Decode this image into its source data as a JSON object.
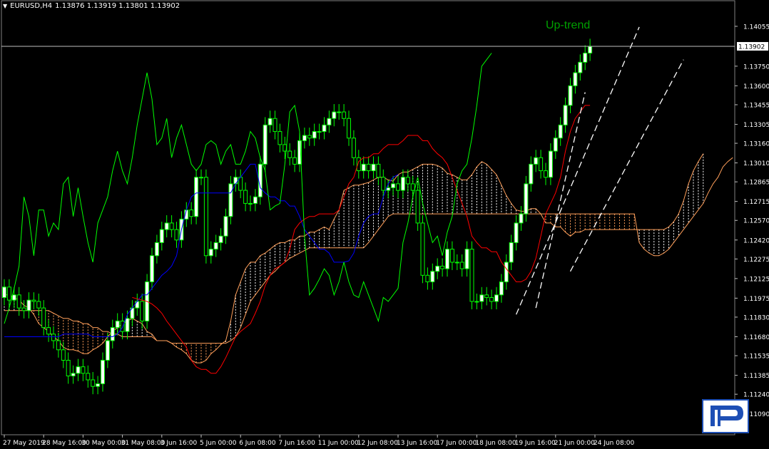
{
  "header": {
    "menu_icon": "triangle-down-icon",
    "symbol": "EURUSD,H4",
    "ohlc": "1.13876 1.13919 1.13801 1.13902"
  },
  "colors": {
    "background": "#000000",
    "bull_candle": "#ffffff",
    "bear_candle": "#000000",
    "candle_outline": "#00ff00",
    "tenkan": "#ff0000",
    "kijun": "#0000ff",
    "chikou": "#00ff00",
    "kumo_bull": "#ffffff",
    "kumo_bear": "#ff9f5a",
    "trend_line": "#ffffff",
    "annotation": "#00a000",
    "price_line": "#c0c0c0"
  },
  "chart_data": {
    "type": "candlestick",
    "symbol": "EURUSD",
    "timeframe": "H4",
    "indicator": "Ichimoku Kinko Hyo",
    "annotation": "Up-trend",
    "current_price": 1.13902,
    "current_price_label": "1.13902",
    "ylim": [
      1.1093,
      1.1418
    ],
    "y_ticks": [
      "1.14055",
      "1.13750",
      "1.13600",
      "1.13455",
      "1.13305",
      "1.13160",
      "1.13010",
      "1.12865",
      "1.12715",
      "1.12570",
      "1.12420",
      "1.12275",
      "1.12125",
      "1.11975",
      "1.11830",
      "1.11680",
      "1.11535",
      "1.11385",
      "1.11240",
      "1.11090"
    ],
    "y_tick_values": [
      1.14055,
      1.1375,
      1.136,
      1.13455,
      1.13305,
      1.1316,
      1.1301,
      1.12865,
      1.12715,
      1.1257,
      1.1242,
      1.12275,
      1.12125,
      1.11975,
      1.1183,
      1.1168,
      1.11535,
      1.11385,
      1.1124,
      1.1109
    ],
    "x_ticks": [
      "27 May 2019",
      "28 May 16:00",
      "30 May 00:00",
      "31 May 08:00",
      "3 Jun 16:00",
      "5 Jun 00:00",
      "6 Jun 08:00",
      "7 Jun 16:00",
      "11 Jun 00:00",
      "12 Jun 08:00",
      "13 Jun 16:00",
      "17 Jun 00:00",
      "18 Jun 08:00",
      "19 Jun 16:00",
      "21 Jun 00:00",
      "24 Jun 08:00"
    ],
    "x_tick_index": [
      0,
      8,
      16,
      24,
      32,
      40,
      48,
      56,
      64,
      72,
      80,
      88,
      96,
      104,
      112,
      120
    ],
    "total_slots": 149,
    "candles_close": [
      1.1206,
      1.1196,
      1.12,
      1.119,
      1.1188,
      1.1196,
      1.1195,
      1.119,
      1.1175,
      1.117,
      1.1165,
      1.1158,
      1.115,
      1.1138,
      1.114,
      1.1145,
      1.114,
      1.1135,
      1.113,
      1.1132,
      1.115,
      1.1165,
      1.1175,
      1.118,
      1.1172,
      1.1182,
      1.119,
      1.1195,
      1.118,
      1.121,
      1.123,
      1.124,
      1.125,
      1.1255,
      1.125,
      1.1242,
      1.1258,
      1.1265,
      1.126,
      1.129,
      1.129,
      1.123,
      1.1235,
      1.124,
      1.1245,
      1.126,
      1.1285,
      1.129,
      1.128,
      1.127,
      1.127,
      1.1275,
      1.13,
      1.133,
      1.1335,
      1.1325,
      1.1315,
      1.131,
      1.1305,
      1.13,
      1.1318,
      1.1322,
      1.132,
      1.1325,
      1.1325,
      1.133,
      1.1335,
      1.134,
      1.134,
      1.1335,
      1.132,
      1.1305,
      1.1295,
      1.13,
      1.1295,
      1.13,
      1.129,
      1.128,
      1.1282,
      1.1285,
      1.128,
      1.129,
      1.1285,
      1.128,
      1.1255,
      1.1215,
      1.121,
      1.1218,
      1.1222,
      1.122,
      1.1235,
      1.1225,
      1.1225,
      1.122,
      1.1235,
      1.1195,
      1.1195,
      1.12,
      1.1198,
      1.1195,
      1.12,
      1.121,
      1.1225,
      1.124,
      1.1255,
      1.1262,
      1.1285,
      1.13,
      1.1305,
      1.1295,
      1.129,
      1.131,
      1.132,
      1.133,
      1.1345,
      1.136,
      1.137,
      1.1378,
      1.1385,
      1.139
    ],
    "tenkan_sen": [
      1.1198,
      1.1197,
      1.1196,
      1.1195,
      1.1193,
      1.119,
      1.1186,
      1.118,
      1.1175,
      1.117,
      1.1165,
      1.116,
      1.115,
      1.1145,
      1.1143,
      1.1143,
      1.114,
      1.114,
      1.1145,
      1.1152,
      1.116,
      1.1168,
      1.1172,
      1.1175,
      1.1178,
      1.1186,
      1.1195,
      1.1207,
      1.1215,
      1.122,
      1.1222,
      1.1225,
      1.1235,
      1.125,
      1.1255,
      1.1258,
      1.126,
      1.126,
      1.1262,
      1.1262,
      1.1262,
      1.1262,
      1.1265,
      1.1275,
      1.1285,
      1.129,
      1.1302,
      1.1305,
      1.1305,
      1.1308,
      1.1308,
      1.1312,
      1.1315,
      1.1315,
      1.1315,
      1.1318,
      1.1322,
      1.1322,
      1.1322,
      1.1318,
      1.1318,
      1.1312,
      1.1308,
      1.1305,
      1.13,
      1.129,
      1.128,
      1.127,
      1.126,
      1.1245,
      1.124,
      1.1236,
      1.1236,
      1.1233,
      1.1233,
      1.1225,
      1.122,
      1.1215,
      1.121,
      1.121,
      1.1212,
      1.1218,
      1.1228,
      1.1245,
      1.1262,
      1.127,
      1.1278,
      1.129,
      1.131,
      1.1325,
      1.1335,
      1.134,
      1.1345,
      1.1345
    ],
    "kijun_sen": [
      1.1168,
      1.1168,
      1.1168,
      1.1168,
      1.1168,
      1.1168,
      1.1168,
      1.1168,
      1.1168,
      1.1168,
      1.1168,
      1.1168,
      1.117,
      1.117,
      1.117,
      1.117,
      1.117,
      1.117,
      1.1168,
      1.1168,
      1.1168,
      1.1168,
      1.1168,
      1.117,
      1.1175,
      1.1185,
      1.119,
      1.1195,
      1.12,
      1.12,
      1.1205,
      1.121,
      1.1215,
      1.1218,
      1.1222,
      1.123,
      1.125,
      1.1265,
      1.1275,
      1.1278,
      1.1278,
      1.1278,
      1.1278,
      1.1278,
      1.1278,
      1.1278,
      1.1278,
      1.1285,
      1.129,
      1.1295,
      1.13,
      1.13,
      1.1282,
      1.1278,
      1.1275,
      1.1275,
      1.1272,
      1.1272,
      1.1268,
      1.1268,
      1.126,
      1.125,
      1.1245,
      1.124,
      1.1235,
      1.1235,
      1.1232,
      1.1225,
      1.1225,
      1.1225,
      1.1226,
      1.1232,
      1.1245,
      1.1255,
      1.126,
      1.1262,
      1.1262,
      1.1275,
      1.1285,
      1.129,
      1.1292
    ],
    "senkou_span_a": [
      1.12,
      1.12,
      1.1198,
      1.1196,
      1.1192,
      1.119,
      1.1185,
      1.1178,
      1.1175,
      1.1172,
      1.1168,
      1.1165,
      1.116,
      1.1158,
      1.1158,
      1.1157,
      1.1155,
      1.1155,
      1.1158,
      1.116,
      1.1163,
      1.1168,
      1.1172,
      1.1175,
      1.1178,
      1.118,
      1.1182,
      1.118,
      1.1178,
      1.1172,
      1.117,
      1.1165,
      1.1165,
      1.1165,
      1.1163,
      1.116,
      1.1158,
      1.1155,
      1.115,
      1.1148,
      1.1148,
      1.115,
      1.1155,
      1.1158,
      1.1162,
      1.1165,
      1.118,
      1.12,
      1.121,
      1.122,
      1.1225,
      1.1225,
      1.123,
      1.1232,
      1.1235,
      1.1238,
      1.124,
      1.124,
      1.1242,
      1.1242,
      1.1245,
      1.1245,
      1.1248,
      1.1248,
      1.125,
      1.1252,
      1.125,
      1.1258,
      1.1265,
      1.128,
      1.1282,
      1.1284,
      1.1284,
      1.1285,
      1.1286,
      1.1288,
      1.129,
      1.129,
      1.1288,
      1.1287,
      1.1292,
      1.1294,
      1.1294,
      1.1296,
      1.1298,
      1.13,
      1.13,
      1.13,
      1.1299,
      1.1297,
      1.1293,
      1.1292,
      1.129,
      1.1288,
      1.1288,
      1.1292,
      1.1298,
      1.1302,
      1.13,
      1.1296,
      1.1292,
      1.1284,
      1.1276,
      1.127,
      1.1265,
      1.1264,
      1.1264,
      1.1266,
      1.1266,
      1.1262,
      1.1255,
      1.1255,
      1.1252,
      1.1252,
      1.1248,
      1.1245,
      1.1248,
      1.1248,
      1.125,
      1.125,
      1.125,
      1.125,
      1.125,
      1.125,
      1.125,
      1.125,
      1.125,
      1.125,
      1.125,
      1.125,
      1.125,
      1.125,
      1.125,
      1.125,
      1.125,
      1.1252,
      1.1256,
      1.1262,
      1.1272,
      1.1285,
      1.1295,
      1.1302,
      1.1308
    ],
    "senkou_span_b": [
      1.1188,
      1.1188,
      1.1188,
      1.1188,
      1.1188,
      1.1188,
      1.1188,
      1.1188,
      1.1188,
      1.1188,
      1.1186,
      1.1184,
      1.1182,
      1.1182,
      1.118,
      1.118,
      1.1178,
      1.1178,
      1.1175,
      1.1175,
      1.1172,
      1.1172,
      1.117,
      1.117,
      1.1168,
      1.1168,
      1.1168,
      1.1168,
      1.1168,
      1.1168,
      1.1168,
      1.1165,
      1.1165,
      1.1165,
      1.1163,
      1.1163,
      1.1163,
      1.1163,
      1.1163,
      1.1163,
      1.1163,
      1.1163,
      1.1163,
      1.1163,
      1.1163,
      1.1163,
      1.1165,
      1.1168,
      1.1175,
      1.1185,
      1.1195,
      1.12,
      1.1205,
      1.121,
      1.1215,
      1.1218,
      1.1222,
      1.1225,
      1.1228,
      1.123,
      1.1232,
      1.1234,
      1.1236,
      1.1236,
      1.1236,
      1.1236,
      1.1236,
      1.1236,
      1.1236,
      1.1236,
      1.1236,
      1.1236,
      1.1236,
      1.1236,
      1.124,
      1.1245,
      1.125,
      1.1255,
      1.126,
      1.1262,
      1.1262,
      1.1262,
      1.1262,
      1.1262,
      1.1262,
      1.1262,
      1.1262,
      1.1262,
      1.1262,
      1.1262,
      1.1262,
      1.1262,
      1.1262,
      1.1262,
      1.1262,
      1.1262,
      1.1262,
      1.1262,
      1.1262,
      1.1262,
      1.1262,
      1.1262,
      1.1262,
      1.1262,
      1.1262,
      1.1262,
      1.1262,
      1.1262,
      1.1262,
      1.1262,
      1.1262,
      1.1262,
      1.1262,
      1.1262,
      1.1262,
      1.1262,
      1.1262,
      1.1262,
      1.1262,
      1.1262,
      1.1262,
      1.1262,
      1.1262,
      1.1262,
      1.1262,
      1.1262,
      1.1262,
      1.1262,
      1.1262,
      1.124,
      1.1235,
      1.1232,
      1.123,
      1.123,
      1.1232,
      1.1235,
      1.124,
      1.1245,
      1.125,
      1.1255,
      1.126,
      1.1265,
      1.127,
      1.1278,
      1.1285,
      1.129,
      1.1298,
      1.1302,
      1.1305
    ],
    "chikou_span": [
      1.1178,
      1.119,
      1.1205,
      1.1222,
      1.1275,
      1.126,
      1.123,
      1.1265,
      1.1265,
      1.1245,
      1.1255,
      1.125,
      1.1285,
      1.129,
      1.126,
      1.1282,
      1.126,
      1.124,
      1.1225,
      1.1255,
      1.1265,
      1.1275,
      1.1295,
      1.131,
      1.1295,
      1.1285,
      1.1305,
      1.133,
      1.135,
      1.137,
      1.135,
      1.1315,
      1.132,
      1.1335,
      1.1305,
      1.132,
      1.133,
      1.1315,
      1.13,
      1.1295,
      1.13,
      1.1315,
      1.1318,
      1.1315,
      1.13,
      1.131,
      1.1315,
      1.13,
      1.13,
      1.131,
      1.1325,
      1.132,
      1.1305,
      1.1295,
      1.1265,
      1.1268,
      1.127,
      1.13,
      1.134,
      1.1345,
      1.1325,
      1.1245,
      1.12,
      1.1205,
      1.1212,
      1.122,
      1.1215,
      1.12,
      1.121,
      1.1225,
      1.121,
      1.12,
      1.1198,
      1.121,
      1.12,
      1.119,
      1.118,
      1.1198,
      1.1195,
      1.12,
      1.1205,
      1.124,
      1.1255,
      1.1275,
      1.129,
      1.127,
      1.1255,
      1.124,
      1.1245,
      1.123,
      1.1248,
      1.126,
      1.1285,
      1.1295,
      1.13,
      1.132,
      1.1345,
      1.1375,
      1.138,
      1.1385
    ],
    "trend_lines": [
      {
        "x": [
          104,
          129
        ],
        "y": [
          1.1185,
          1.1405
        ]
      },
      {
        "x": [
          115,
          138
        ],
        "y": [
          1.1218,
          1.138
        ]
      },
      {
        "x": [
          108,
          118
        ],
        "y": [
          1.119,
          1.1355
        ]
      }
    ]
  }
}
